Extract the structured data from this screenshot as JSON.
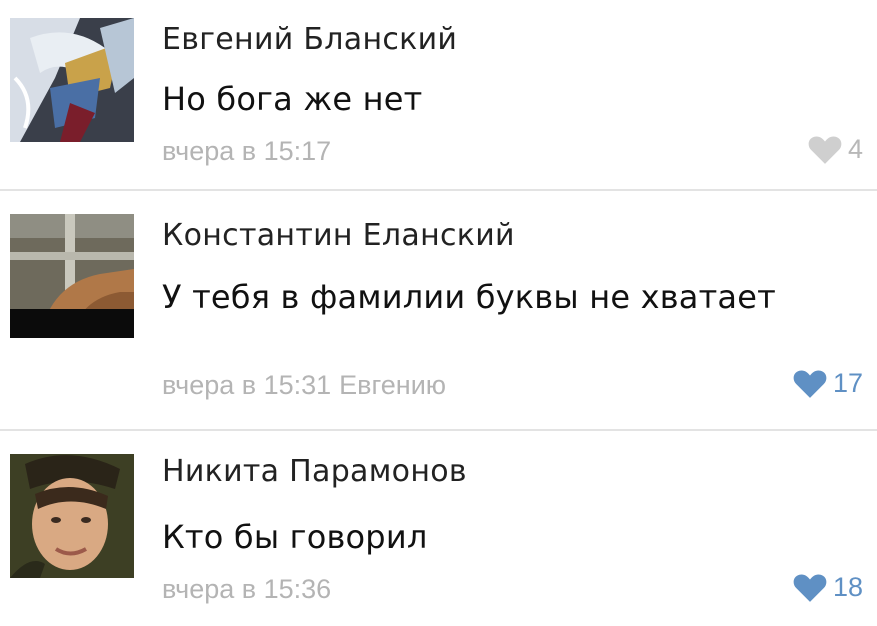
{
  "comments": [
    {
      "author": "Евгений Бланский",
      "text": "Но бога же нет",
      "time": "вчера в 15:17",
      "reply_to": "",
      "likes": "4",
      "liked": false,
      "avatar_icon": "anime-character-avatar"
    },
    {
      "author": "Константин Еланский",
      "text": "У тебя в фамилии буквы не хватает",
      "time": "вчера в 15:31",
      "reply_to": "Евгению",
      "likes": "17",
      "liked": true,
      "avatar_icon": "photo-avatar"
    },
    {
      "author": "Никита Парамонов",
      "text": "Кто бы говорил",
      "time": "вчера в 15:36",
      "reply_to": "",
      "likes": "18",
      "liked": true,
      "avatar_icon": "person-photo-avatar"
    }
  ],
  "colors": {
    "like_active": "#5f90c4",
    "like_inactive": "#cfcfcf",
    "meta_text": "#b4b4b4"
  }
}
